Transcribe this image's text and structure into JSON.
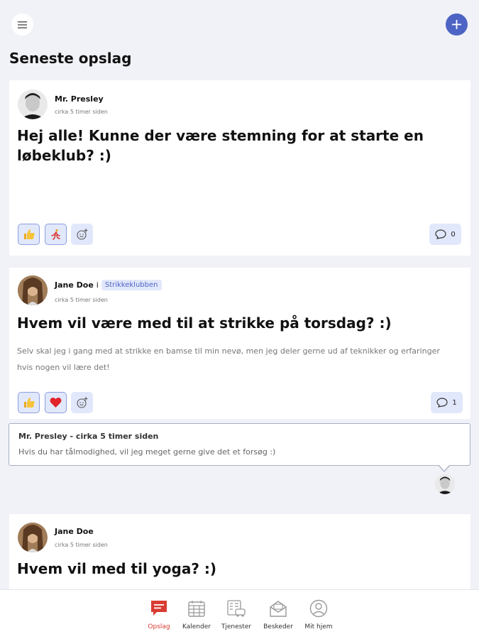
{
  "app": {
    "page_title": "Seneste opslag",
    "colors": {
      "accent": "#4d64c5",
      "active_tab": "#d93c33",
      "reaction_bg": "#e2e8fb"
    }
  },
  "posts": [
    {
      "author": "Mr. Presley",
      "group_prefix": "",
      "group": "",
      "time": "cirka 5 timer siden",
      "title": "Hej alle! Kunne der være stemning for at starte en løbeklub? :)",
      "body": "",
      "reactions": [
        "thumbs-up-icon",
        "runner-icon",
        "add-reaction-icon"
      ],
      "comment_count": "0"
    },
    {
      "author": "Jane Doe",
      "group_prefix": "i",
      "group": "Strikkeklubben",
      "time": "cirka 5 timer siden",
      "title": "Hvem vil være med til at strikke på torsdag? :)",
      "body": "Selv skal jeg i gang med at strikke en bamse til min nevø, men jeg deler gerne ud af teknikker og erfaringer hvis nogen vil lære det!",
      "reactions": [
        "thumbs-up-icon",
        "heart-icon",
        "add-reaction-icon"
      ],
      "comment_count": "1",
      "latest_comment": {
        "meta": "Mr. Presley - cirka 5 timer siden",
        "text": "Hvis du har tålmodighed, vil jeg meget gerne give det et forsøg :)"
      }
    },
    {
      "author": "Jane Doe",
      "time": "cirka 5 timer siden",
      "title": "Hvem vil med til yoga? :)"
    }
  ],
  "tabs": [
    {
      "label": "Opslag",
      "icon": "posts-icon",
      "active": true
    },
    {
      "label": "Kalender",
      "icon": "calendar-icon",
      "active": false
    },
    {
      "label": "Tjenester",
      "icon": "services-icon",
      "active": false
    },
    {
      "label": "Beskeder",
      "icon": "messages-icon",
      "active": false
    },
    {
      "label": "Mit hjem",
      "icon": "profile-icon",
      "active": false
    }
  ]
}
